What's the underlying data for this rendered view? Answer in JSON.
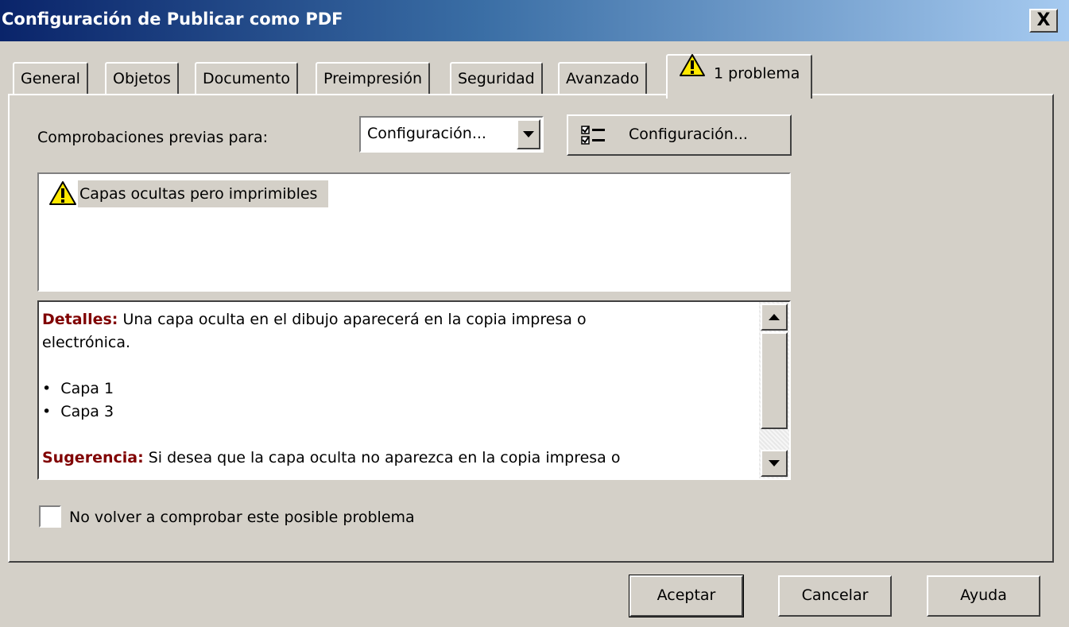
{
  "window": {
    "title": "Configuración de Publicar como PDF",
    "close_label": "X"
  },
  "tabs": [
    {
      "label": "General",
      "active": false
    },
    {
      "label": "Objetos",
      "active": false
    },
    {
      "label": "Documento",
      "active": false
    },
    {
      "label": "Preimpresión",
      "active": false
    },
    {
      "label": "Seguridad",
      "active": false
    },
    {
      "label": "Avanzado",
      "active": false
    },
    {
      "label": "1 problema",
      "active": true,
      "icon": "warning-icon"
    }
  ],
  "preflight": {
    "label": "Comprobaciones previas para:",
    "selected": "Configuración...",
    "settings_button_label": "Configuración...",
    "settings_button_icon": "checklist-icon"
  },
  "issues": [
    {
      "icon": "warning-icon",
      "text": "Capas ocultas pero imprimibles",
      "selected": true
    }
  ],
  "details": {
    "details_keyword": "Detalles:",
    "details_text_1": "Una capa oculta en el dibujo aparecerá en la copia impresa o",
    "details_text_2": "electrónica.",
    "bullets": [
      "Capa 1",
      "Capa 3"
    ],
    "suggestion_keyword": "Sugerencia:",
    "suggestion_text": "Si desea que la capa oculta no aparezca en la copia impresa o"
  },
  "checkbox": {
    "label": "No volver a comprobar este posible problema",
    "checked": false
  },
  "buttons": {
    "ok": "Aceptar",
    "cancel": "Cancelar",
    "help": "Ayuda"
  },
  "colors": {
    "keyword": "#800000",
    "dialog_bg": "#d4d0c8",
    "title_start": "#0a246a",
    "title_end": "#a6caf0"
  }
}
